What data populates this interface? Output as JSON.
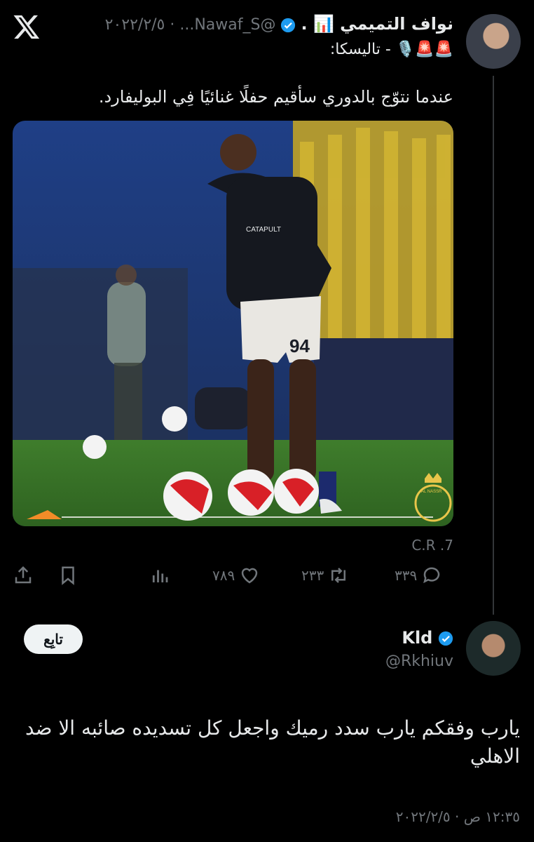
{
  "tweet": {
    "author_name": "نواف التميمي 📊 .",
    "handle_and_date": "@Nawaf_S... · ٢٠٢٢/٢/٥",
    "bio_line": "🚨🚨🎙️ - تاليسكا:",
    "text": "عندما نتوّج بالدوري سأقيم حفلًا غنائيًا فِي البوليفارد.",
    "photo_caption": "C.R .7",
    "actions": {
      "replies": "٣٣٩",
      "retweets": "٢٣٣",
      "likes": "٧٨٩"
    },
    "photo_texts": {
      "shirt_sponsor": "CATAPULT",
      "shorts_number": "94",
      "crest_text": "AL NASSR"
    }
  },
  "reply": {
    "author_name": "Kld",
    "handle": "@Rkhiuv",
    "follow_label": "تابِع",
    "text": "يارب وفقكم يارب سدد رميك واجعل كل تسديده صائبه الا ضد الاهلي",
    "timestamp": "١٢:٣٥ ص · ٢٠٢٢/٢/٥"
  },
  "colors": {
    "background": "#000000",
    "text": "#e7e9ea",
    "muted": "#71767b",
    "verified": "#1d9bf0",
    "follow_bg": "#eff3f4"
  },
  "icons": [
    "x-logo-icon",
    "verified-icon",
    "reply-icon",
    "retweet-icon",
    "like-icon",
    "views-icon",
    "bookmark-icon",
    "share-icon"
  ]
}
